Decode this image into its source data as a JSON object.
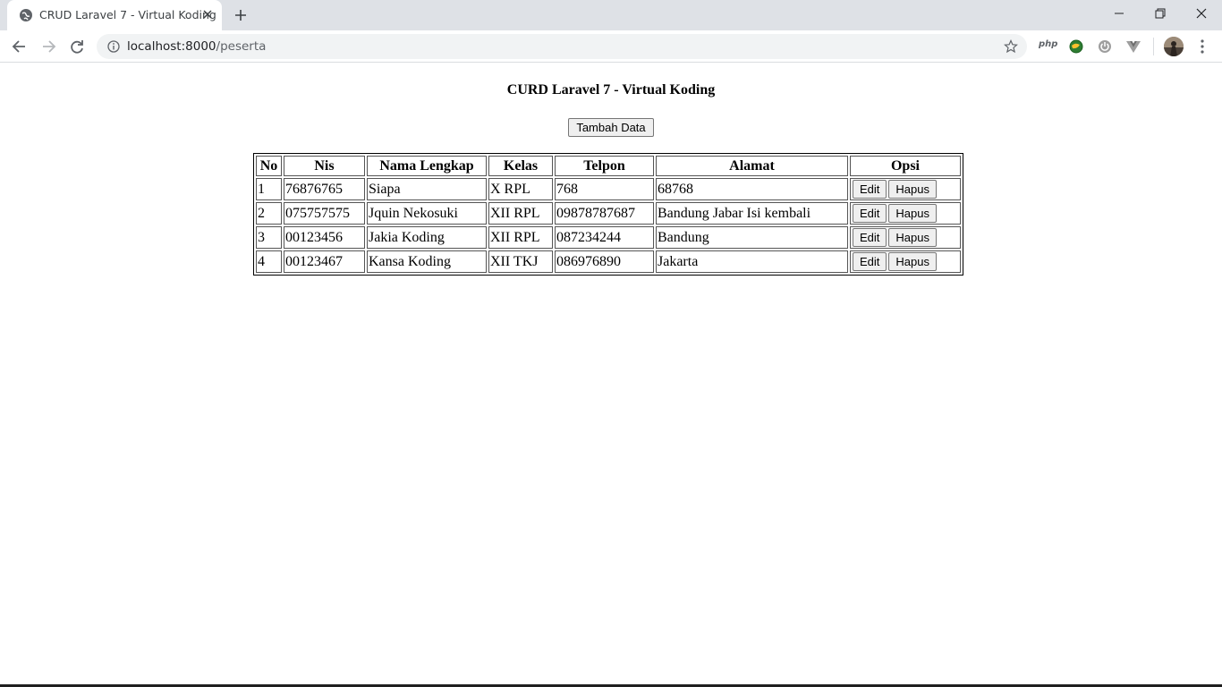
{
  "browser": {
    "tab_title": "CRUD Laravel 7 - Virtual Koding",
    "url_host": "localhost:8000",
    "url_path": "/peserta",
    "ext_php_label": "php"
  },
  "page": {
    "title": "CURD Laravel 7 - Virtual Koding",
    "add_button": "Tambah Data"
  },
  "table": {
    "headers": [
      "No",
      "Nis",
      "Nama Lengkap",
      "Kelas",
      "Telpon",
      "Alamat",
      "Opsi"
    ],
    "rows": [
      {
        "no": "1",
        "nis": "76876765",
        "nama": "Siapa",
        "kelas": "X RPL",
        "telpon": "768",
        "alamat": "68768"
      },
      {
        "no": "2",
        "nis": "075757575",
        "nama": "Jquin Nekosuki",
        "kelas": "XII RPL",
        "telpon": "09878787687",
        "alamat": "Bandung Jabar Isi kembali"
      },
      {
        "no": "3",
        "nis": "00123456",
        "nama": "Jakia Koding",
        "kelas": "XII RPL",
        "telpon": "087234244",
        "alamat": "Bandung"
      },
      {
        "no": "4",
        "nis": "00123467",
        "nama": "Kansa Koding",
        "kelas": "XII TKJ",
        "telpon": "086976890",
        "alamat": "Jakarta"
      }
    ],
    "edit_label": "Edit",
    "delete_label": "Hapus"
  }
}
